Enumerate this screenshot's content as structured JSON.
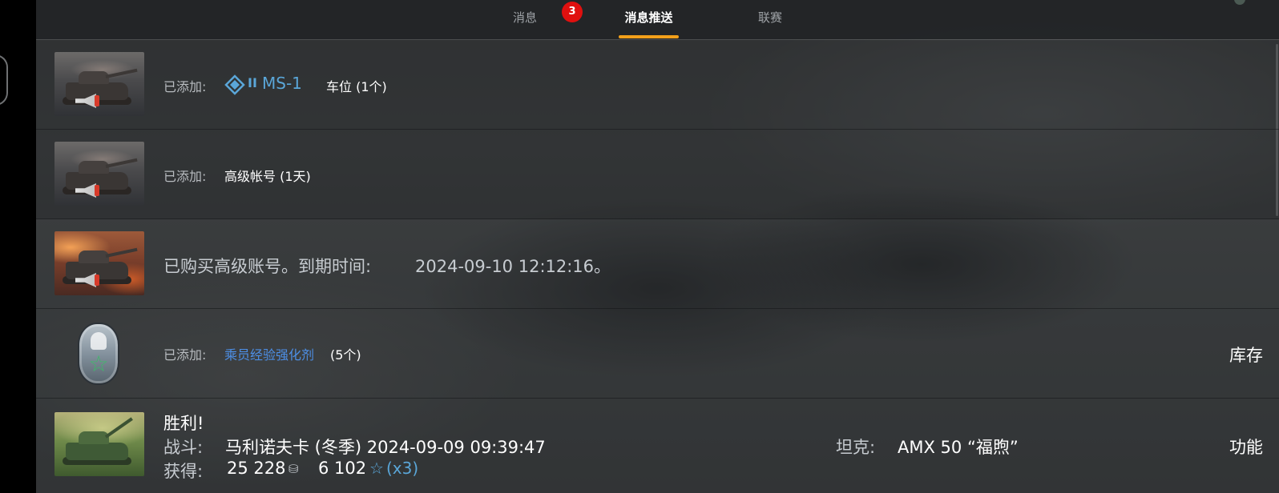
{
  "tabs": [
    {
      "label": "消息",
      "active": false
    },
    {
      "label": "消息推送",
      "active": true
    },
    {
      "label": "联赛",
      "active": false
    }
  ],
  "badge_count": "3",
  "colors": {
    "accent": "#f2a01a",
    "badge": "#e0100f",
    "vehicle_link": "#5aa6d8",
    "item_link": "#4d8fe6"
  },
  "rows": [
    {
      "icon": "tank-megaphone-icon",
      "prefix": "已添加:",
      "tier": "II",
      "vehicle": "MS-1",
      "suffix": "车位 (1个)"
    },
    {
      "icon": "tank-megaphone-icon",
      "prefix": "已添加:",
      "item": "高级帐号 (1天)"
    },
    {
      "icon": "tank-fire-megaphone-icon",
      "text": "已购买高级账号。到期时间:",
      "date": "2024-09-10 12:12:16。"
    },
    {
      "icon": "crew-medal-icon",
      "prefix": "已添加:",
      "item": "乘员经验强化剂",
      "count": "(5个)",
      "action": "库存"
    },
    {
      "icon": "green-tank-icon",
      "title": "胜利!",
      "battle_label": "战斗:",
      "battle_value": "马利诺夫卡 (冬季) 2024-09-09 09:39:47",
      "tank_label": "坦克:",
      "tank_value": "AMX 50 “福煦”",
      "earn_label": "获得:",
      "credits": "25 228",
      "credits_icon": "silver-coins-icon",
      "xp": "6 102",
      "xp_icon": "star-icon",
      "multiplier": "(x3)",
      "action": "功能"
    }
  ]
}
